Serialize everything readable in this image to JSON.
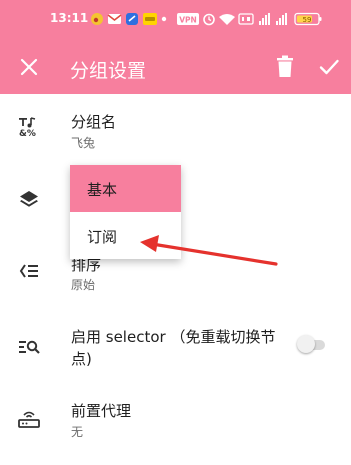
{
  "status_bar": {
    "time": "13:11",
    "badge": "59",
    "icons_left": [
      "weibo-icon",
      "gmail-icon",
      "app-icon",
      "paypal-icon",
      "dot-icon"
    ],
    "icons_right": [
      "vpn-icon",
      "alarm-icon",
      "wifi-icon",
      "hd-icon",
      "signal-icon",
      "signal-icon",
      "battery-icon"
    ],
    "vpn_label": "VPN"
  },
  "app_bar": {
    "title": "分组设置",
    "close_icon": "close-icon",
    "delete_icon": "delete-icon",
    "confirm_icon": "check-icon"
  },
  "settings": {
    "group_name": {
      "title": "分组名",
      "value": "飞兔",
      "icon": "text-format-icon"
    },
    "type": {
      "icon": "layers-icon"
    },
    "sort": {
      "title": "排序",
      "value": "原始",
      "icon": "sort-icon"
    },
    "selector": {
      "title_line1": "启用 selector （免重载切换节",
      "title_line2": "点)",
      "icon": "list-search-icon",
      "enabled": false
    },
    "front_proxy": {
      "title": "前置代理",
      "value": "无",
      "icon": "router-icon"
    }
  },
  "type_menu": {
    "options": [
      "基本",
      "订阅"
    ],
    "selected": "基本"
  },
  "colors": {
    "accent": "#F77F9E",
    "annotation_arrow": "#E5322D",
    "text_primary": "#1f1f1f",
    "text_secondary": "#6b6b6b"
  }
}
